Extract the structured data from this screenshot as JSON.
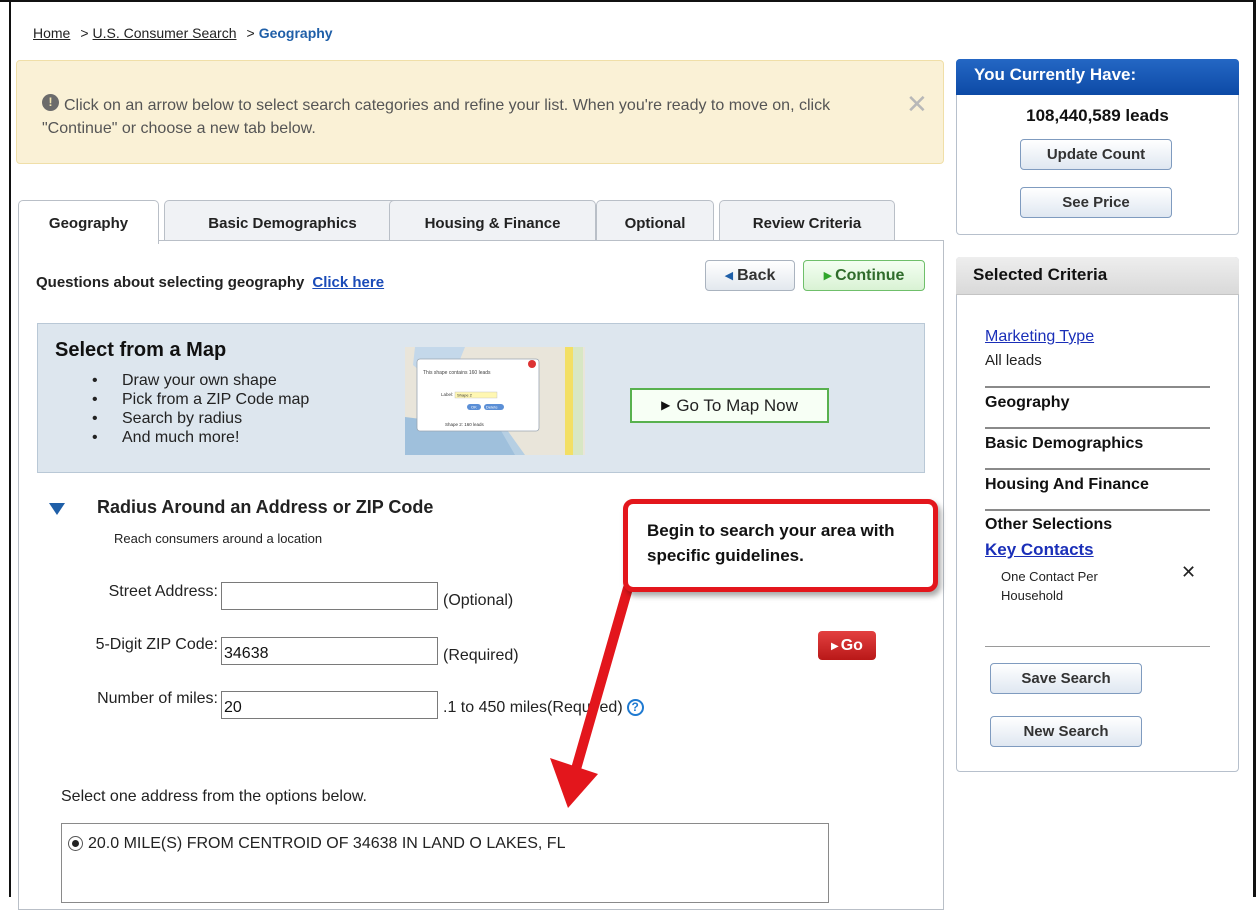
{
  "breadcrumb": {
    "home": "Home",
    "search": "U.S. Consumer Search",
    "current": "Geography",
    "separator": ">"
  },
  "notice": {
    "icon": "lightbulb-icon",
    "message": "Click on an arrow below to select search categories and refine your list. When you're ready to move on, click \"Continue\" or choose a new tab below.",
    "close": "✕"
  },
  "tabs": [
    {
      "label": "Geography",
      "active": true
    },
    {
      "label": "Basic Demographics",
      "active": false
    },
    {
      "label": "Housing & Finance",
      "active": false
    },
    {
      "label": "Optional",
      "active": false
    },
    {
      "label": "Review Criteria",
      "active": false
    }
  ],
  "questions": {
    "text": "Questions about selecting geography",
    "link": "Click here"
  },
  "nav": {
    "back": "Back",
    "continue": "Continue"
  },
  "map_section": {
    "title": "Select from a Map",
    "items": [
      "Draw your own shape",
      "Pick from a ZIP Code map",
      "Search by radius",
      "And much more!"
    ],
    "thumb": {
      "popup_text": "This shape contains 160 leads",
      "label_text": "Label:",
      "label_value": "Shape 2",
      "ok": "OK",
      "delete": "Delete",
      "shape_label": "Shape 2: 160 leads"
    },
    "button": "Go To Map Now"
  },
  "radius": {
    "title": "Radius Around an Address or ZIP Code",
    "subtitle": "Reach consumers around a location",
    "fields": {
      "street_label": "Street Address:",
      "street_value": "",
      "street_note": "(Optional)",
      "zip_label": "5-Digit ZIP Code:",
      "zip_value": "34638",
      "zip_note": "(Required)",
      "miles_label": "Number of miles:",
      "miles_value": "20",
      "miles_note": ".1 to 450 miles(Required)"
    },
    "go": "Go",
    "select_label": "Select one address from the options below.",
    "option": "20.0 MILE(S) FROM CENTROID OF 34638 IN LAND O LAKES, FL"
  },
  "callout": {
    "text": "Begin to search your area with specific guidelines."
  },
  "count_panel": {
    "title": "You Currently Have:",
    "count": "108,440,589 leads",
    "update": "Update Count",
    "price": "See Price"
  },
  "criteria_panel": {
    "title": "Selected Criteria",
    "marketing_link": "Marketing Type",
    "marketing_value": "All leads",
    "geography": "Geography",
    "basic": "Basic Demographics",
    "housing": "Housing And Finance",
    "other": "Other Selections",
    "key_contacts": "Key Contacts",
    "contact_value": "One Contact Per Household",
    "save": "Save Search",
    "new": "New Search"
  },
  "colors": {
    "accent_blue": "#0d4aa6",
    "continue_green": "#6fbf6a",
    "go_red": "#b91818",
    "callout_red": "#e3161c",
    "notice_bg": "#faf1d6"
  }
}
